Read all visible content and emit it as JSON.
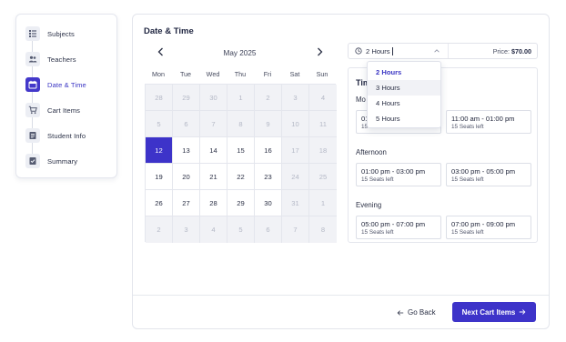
{
  "steps": [
    {
      "label": "Subjects",
      "icon": "list-icon",
      "active": false
    },
    {
      "label": "Teachers",
      "icon": "users-icon",
      "active": false
    },
    {
      "label": "Date & Time",
      "icon": "calendar-icon",
      "active": true
    },
    {
      "label": "Cart Items",
      "icon": "cart-icon",
      "active": false
    },
    {
      "label": "Student Info",
      "icon": "document-icon",
      "active": false
    },
    {
      "label": "Summary",
      "icon": "checklist-icon",
      "active": false
    }
  ],
  "section": {
    "title": "Date & Time"
  },
  "calendar": {
    "month": "May 2025",
    "weekdays": [
      "Mon",
      "Tue",
      "Wed",
      "Thu",
      "Fri",
      "Sat",
      "Sun"
    ],
    "weeks": [
      [
        {
          "d": "28",
          "s": "dis"
        },
        {
          "d": "29",
          "s": "dis"
        },
        {
          "d": "30",
          "s": "dis"
        },
        {
          "d": "1",
          "s": "dis"
        },
        {
          "d": "2",
          "s": "dis"
        },
        {
          "d": "3",
          "s": "dis"
        },
        {
          "d": "4",
          "s": "dis"
        }
      ],
      [
        {
          "d": "5",
          "s": "dis"
        },
        {
          "d": "6",
          "s": "dis"
        },
        {
          "d": "7",
          "s": "dis"
        },
        {
          "d": "8",
          "s": "dis"
        },
        {
          "d": "9",
          "s": "dis"
        },
        {
          "d": "10",
          "s": "dis"
        },
        {
          "d": "11",
          "s": "dis"
        }
      ],
      [
        {
          "d": "12",
          "s": "sel"
        },
        {
          "d": "13",
          "s": "en"
        },
        {
          "d": "14",
          "s": "en"
        },
        {
          "d": "15",
          "s": "en"
        },
        {
          "d": "16",
          "s": "en"
        },
        {
          "d": "17",
          "s": "dis"
        },
        {
          "d": "18",
          "s": "dis"
        }
      ],
      [
        {
          "d": "19",
          "s": "en"
        },
        {
          "d": "20",
          "s": "en"
        },
        {
          "d": "21",
          "s": "en"
        },
        {
          "d": "22",
          "s": "en"
        },
        {
          "d": "23",
          "s": "en"
        },
        {
          "d": "24",
          "s": "dis"
        },
        {
          "d": "25",
          "s": "dis"
        }
      ],
      [
        {
          "d": "26",
          "s": "en"
        },
        {
          "d": "27",
          "s": "en"
        },
        {
          "d": "28",
          "s": "en"
        },
        {
          "d": "29",
          "s": "en"
        },
        {
          "d": "30",
          "s": "en"
        },
        {
          "d": "31",
          "s": "dis"
        },
        {
          "d": "1",
          "s": "dis"
        }
      ],
      [
        {
          "d": "2",
          "s": "dis"
        },
        {
          "d": "3",
          "s": "dis"
        },
        {
          "d": "4",
          "s": "dis"
        },
        {
          "d": "5",
          "s": "dis"
        },
        {
          "d": "6",
          "s": "dis"
        },
        {
          "d": "7",
          "s": "dis"
        },
        {
          "d": "8",
          "s": "dis"
        }
      ]
    ]
  },
  "duration": {
    "value": "2 Hours",
    "options": [
      "2 Hours",
      "3 Hours",
      "4 Hours",
      "5 Hours"
    ],
    "selected_index": 0,
    "hover_index": 1
  },
  "price": {
    "label": "Price:",
    "value": "$70.00"
  },
  "times": {
    "title": "Tim",
    "groups": [
      {
        "name": "Mo",
        "slots": [
          {
            "time": "01",
            "seats": "15"
          },
          {
            "time": "11:00 am - 01:00 pm",
            "seats": "15 Seats left"
          }
        ]
      },
      {
        "name": "Afternoon",
        "slots": [
          {
            "time": "01:00 pm - 03:00 pm",
            "seats": "15 Seats left"
          },
          {
            "time": "03:00 pm - 05:00 pm",
            "seats": "15 Seats left"
          }
        ]
      },
      {
        "name": "Evening",
        "slots": [
          {
            "time": "05:00 pm - 07:00 pm",
            "seats": "15 Seats left"
          },
          {
            "time": "07:00 pm - 09:00 pm",
            "seats": "15 Seats left"
          }
        ]
      }
    ]
  },
  "footer": {
    "back_label": "Go Back",
    "next_label": "Next Cart Items"
  },
  "colors": {
    "accent": "#3d33c9",
    "disabled_bg": "#f1f2f6"
  }
}
